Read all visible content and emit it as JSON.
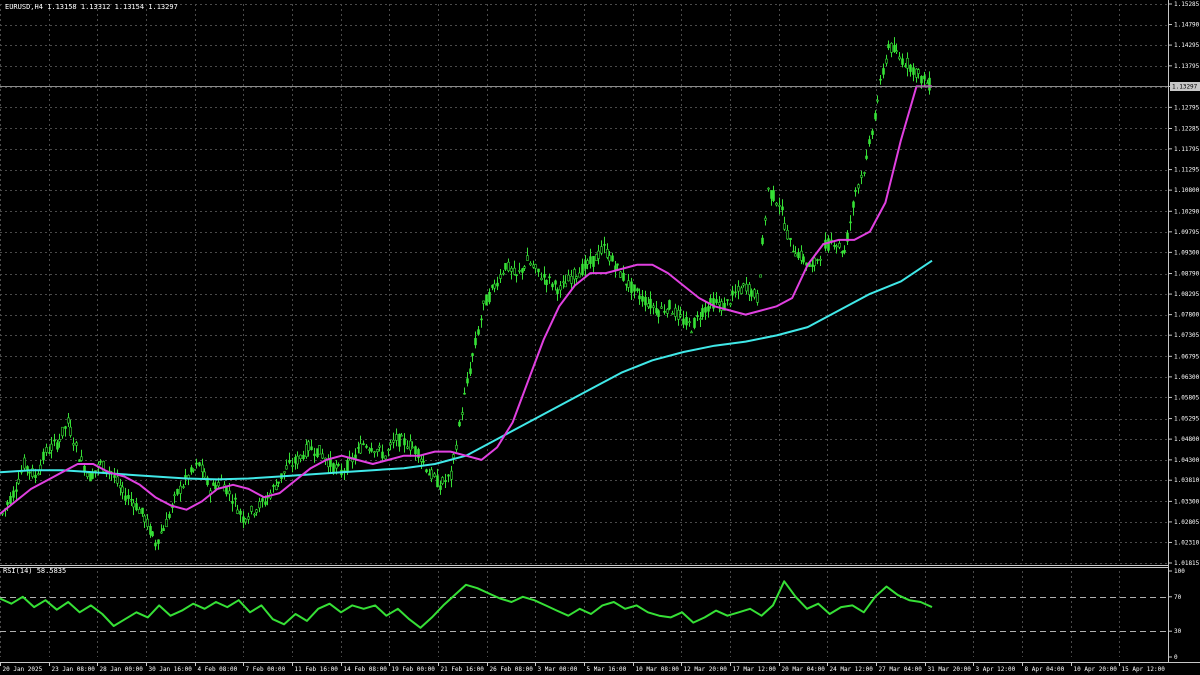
{
  "chart_title": "EURUSD,H4  1.13158 1.13312 1.13154 1.13297",
  "indicator_title": "RSI(14) 58.5835",
  "current_price": "1.13297",
  "colors": {
    "background": "#000000",
    "grid": "#4a4a4a",
    "candles": "#36e036",
    "ma_fast": "#e040e0",
    "ma_slow": "#40e8e8",
    "rsi": "#36e036",
    "axis": "#c8c8c8",
    "price_tag_bg": "#c8c8c8"
  },
  "chart_data": [
    {
      "type": "line",
      "title": "EURUSD,H4  1.13158 1.13312 1.13154 1.13297",
      "ylim": [
        1.01815,
        1.15285
      ],
      "y_ticks": [
        "1.15285",
        "1.14790",
        "1.14295",
        "1.13795",
        "1.13297",
        "1.12795",
        "1.12285",
        "1.11795",
        "1.11295",
        "1.10800",
        "1.10290",
        "1.09795",
        "1.09300",
        "1.08790",
        "1.08295",
        "1.07800",
        "1.07305",
        "1.06795",
        "1.06300",
        "1.05805",
        "1.05295",
        "1.04800",
        "1.04300",
        "1.03810",
        "1.03300",
        "1.02805",
        "1.02310",
        "1.01815"
      ],
      "x_ticks": [
        "20 Jan 2025",
        "23 Jan 08:00",
        "28 Jan 00:00",
        "30 Jan 16:00",
        "4 Feb 08:00",
        "7 Feb 00:00",
        "11 Feb 16:00",
        "14 Feb 08:00",
        "19 Feb 00:00",
        "21 Feb 16:00",
        "26 Feb 08:00",
        "3 Mar 00:00",
        "5 Mar 16:00",
        "10 Mar 08:00",
        "12 Mar 20:00",
        "17 Mar 12:00",
        "20 Mar 04:00",
        "24 Mar 12:00",
        "27 Mar 04:00",
        "31 Mar 20:00",
        "3 Apr 12:00",
        "8 Apr 04:00",
        "10 Apr 20:00",
        "15 Apr 12:00"
      ],
      "series": [
        {
          "values": [
            1.03,
            1.035,
            1.042,
            1.039,
            1.045,
            1.047,
            1.052,
            1.044,
            1.039,
            1.042,
            1.04,
            1.035,
            1.033,
            1.029,
            1.023,
            1.028,
            1.035,
            1.039,
            1.042,
            1.036,
            1.038,
            1.034,
            1.029,
            1.031,
            1.033,
            1.037,
            1.041,
            1.043,
            1.046,
            1.045,
            1.042,
            1.04,
            1.043,
            1.047,
            1.046,
            1.044,
            1.048,
            1.047,
            1.045,
            1.04,
            1.037,
            1.039,
            1.055,
            1.068,
            1.08,
            1.085,
            1.09,
            1.087,
            1.091,
            1.088,
            1.086,
            1.084,
            1.087,
            1.089,
            1.091,
            1.094,
            1.09,
            1.086,
            1.083,
            1.081,
            1.079,
            1.08,
            1.077,
            1.075,
            1.079,
            1.081,
            1.08,
            1.083,
            1.085,
            1.082,
            1.108,
            1.105,
            1.095,
            1.092,
            1.089,
            1.094,
            1.096,
            1.093,
            1.108,
            1.115,
            1.13,
            1.143,
            1.14,
            1.138,
            1.135,
            1.133
          ]
        },
        {
          "values": [
            1.03,
            1.033,
            1.036,
            1.038,
            1.04,
            1.042,
            1.042,
            1.04,
            1.039,
            1.037,
            1.034,
            1.032,
            1.031,
            1.033,
            1.036,
            1.037,
            1.036,
            1.034,
            1.035,
            1.038,
            1.041,
            1.043,
            1.044,
            1.043,
            1.042,
            1.043,
            1.044,
            1.044,
            1.045,
            1.045,
            1.044,
            1.043,
            1.046,
            1.052,
            1.062,
            1.072,
            1.08,
            1.085,
            1.088,
            1.088,
            1.089,
            1.09,
            1.09,
            1.088,
            1.085,
            1.082,
            1.08,
            1.079,
            1.078,
            1.079,
            1.08,
            1.082,
            1.09,
            1.095,
            1.096,
            1.096,
            1.098,
            1.105,
            1.12,
            1.133,
            1.133
          ]
        },
        {
          "values": [
            1.04,
            1.0405,
            1.0405,
            1.04,
            1.0395,
            1.039,
            1.0385,
            1.0383,
            1.0385,
            1.039,
            1.0395,
            1.04,
            1.0405,
            1.041,
            1.042,
            1.044,
            1.048,
            1.052,
            1.056,
            1.06,
            1.064,
            1.067,
            1.069,
            1.0705,
            1.0715,
            1.073,
            1.075,
            1.079,
            1.083,
            1.086,
            1.091
          ]
        }
      ]
    },
    {
      "type": "line",
      "title": "RSI(14) 58.5835",
      "ylim": [
        0,
        100
      ],
      "y_ticks": [
        "100",
        "70",
        "30",
        "0"
      ],
      "levels": [
        70,
        30
      ],
      "series": [
        {
          "values": [
            68,
            62,
            70,
            58,
            66,
            55,
            64,
            52,
            60,
            50,
            36,
            44,
            52,
            46,
            60,
            48,
            54,
            62,
            56,
            64,
            58,
            66,
            52,
            60,
            44,
            38,
            50,
            42,
            56,
            62,
            52,
            60,
            56,
            60,
            48,
            56,
            44,
            34,
            46,
            60,
            72,
            84,
            80,
            74,
            68,
            64,
            70,
            66,
            60,
            54,
            48,
            56,
            50,
            60,
            64,
            56,
            60,
            52,
            48,
            46,
            52,
            40,
            46,
            54,
            48,
            52,
            56,
            48,
            60,
            88,
            70,
            56,
            62,
            50,
            58,
            60,
            52,
            70,
            82,
            72,
            66,
            64,
            58
          ]
        }
      ]
    }
  ]
}
